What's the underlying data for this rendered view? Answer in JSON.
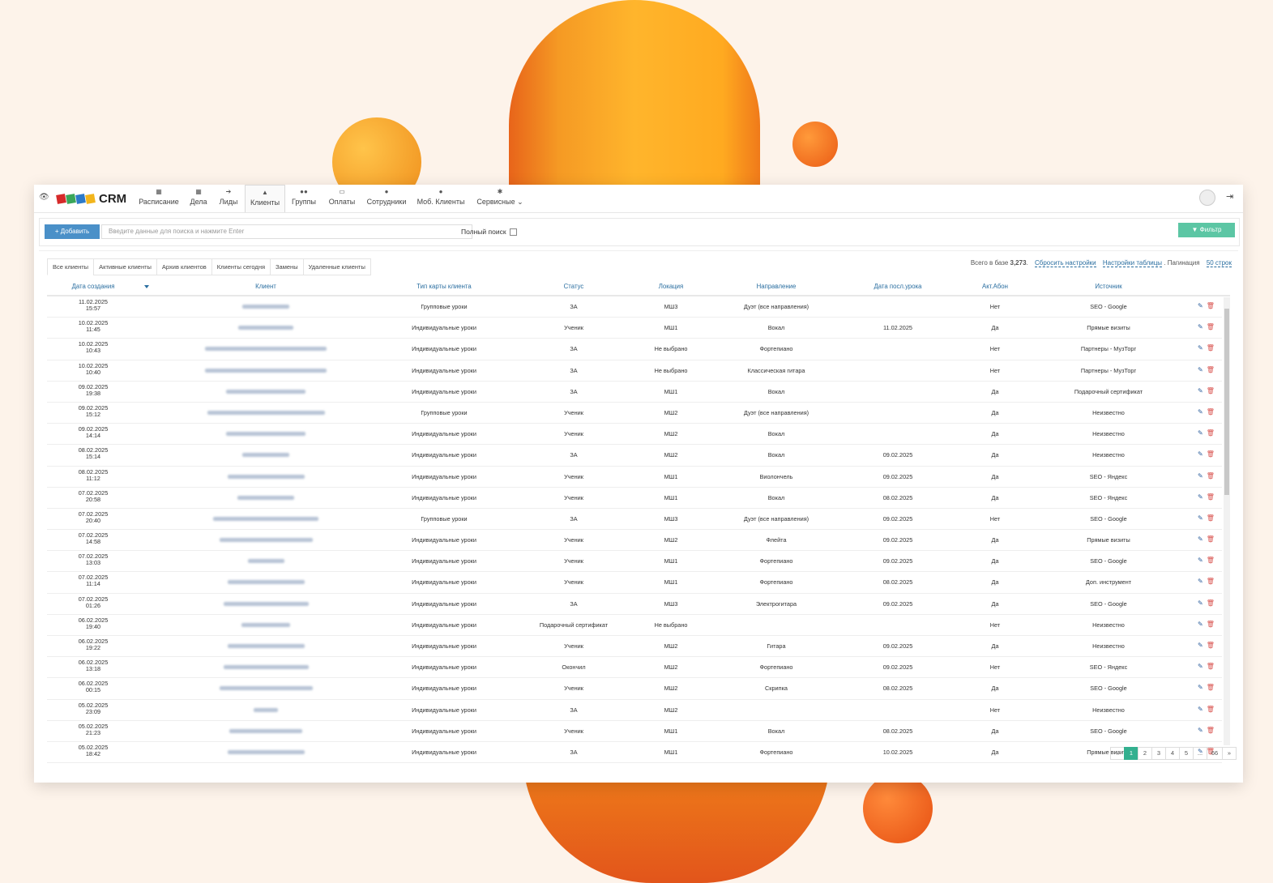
{
  "app": {
    "title": "CRM",
    "logo_colors": [
      "#d62a2a",
      "#3aa65a",
      "#2c7ac9",
      "#f2b51c"
    ]
  },
  "nav": [
    {
      "label": "Расписание",
      "icon": "calendar-icon"
    },
    {
      "label": "Дела",
      "icon": "calendar-check-icon"
    },
    {
      "label": "Лиды",
      "icon": "sign-in-icon"
    },
    {
      "label": "Клиенты",
      "icon": "graduation-cap-icon",
      "active": true
    },
    {
      "label": "Группы",
      "icon": "users-icon"
    },
    {
      "label": "Оплаты",
      "icon": "credit-card-icon"
    },
    {
      "label": "Сотрудники",
      "icon": "user-icon"
    },
    {
      "label": "Моб. Клиенты",
      "icon": "user-icon"
    },
    {
      "label": "Сервисные",
      "icon": "gear-icon"
    }
  ],
  "toolbar": {
    "add_label": "+ Добавить",
    "search_placeholder": "Введите данные для поиска и нажмите Enter",
    "full_search_label": "Полный поиск",
    "filter_label": "▼ Фильтр"
  },
  "tabs": [
    "Все клиенты",
    "Активные клиенты",
    "Архив клиентов",
    "Клиенты сегодня",
    "Замены",
    "Удаленные клиенты"
  ],
  "totals": {
    "prefix": "Всего в базе ",
    "count": "3,273",
    "suffix": ".",
    "reset_label": "Сбросить настройки",
    "table_settings_label": "Настройки таблицы",
    "pagination_prefix": ". Пагинация",
    "pagination_value": "50 строк"
  },
  "columns": [
    "Дата создания",
    "Клиент",
    "Тип карты клиента",
    "Статус",
    "Локация",
    "Направление",
    "Дата посл.урока",
    "Акт.Абон",
    "Источник"
  ],
  "rows": [
    {
      "date": "11.02.2025",
      "time": "15:57",
      "card": "Групповые уроки",
      "status": "ЗА",
      "loc": "МШ3",
      "dir": "Дуэт (все направления)",
      "last": "",
      "abon": "Нет",
      "src": "SEO - Google"
    },
    {
      "date": "10.02.2025",
      "time": "11:45",
      "card": "Индивидуальные уроки",
      "status": "Ученик",
      "loc": "МШ1",
      "dir": "Вокал",
      "last": "11.02.2025",
      "abon": "Да",
      "src": "Прямые визиты"
    },
    {
      "date": "10.02.2025",
      "time": "10:43",
      "card": "Индивидуальные уроки",
      "status": "ЗА",
      "loc": "Не выбрано",
      "dir": "Фортепиано",
      "last": "",
      "abon": "Нет",
      "src": "Партнеры - МузТорг"
    },
    {
      "date": "10.02.2025",
      "time": "10:40",
      "card": "Индивидуальные уроки",
      "status": "ЗА",
      "loc": "Не выбрано",
      "dir": "Классическая гитара",
      "last": "",
      "abon": "Нет",
      "src": "Партнеры - МузТорг"
    },
    {
      "date": "09.02.2025",
      "time": "19:38",
      "card": "Индивидуальные уроки",
      "status": "ЗА",
      "loc": "МШ1",
      "dir": "Вокал",
      "last": "",
      "abon": "Да",
      "src": "Подарочный сертификат"
    },
    {
      "date": "09.02.2025",
      "time": "15:12",
      "card": "Групповые уроки",
      "status": "Ученик",
      "loc": "МШ2",
      "dir": "Дуэт (все направления)",
      "last": "",
      "abon": "Да",
      "src": "Неизвестно"
    },
    {
      "date": "09.02.2025",
      "time": "14:14",
      "card": "Индивидуальные уроки",
      "status": "Ученик",
      "loc": "МШ2",
      "dir": "Вокал",
      "last": "",
      "abon": "Да",
      "src": "Неизвестно"
    },
    {
      "date": "08.02.2025",
      "time": "15:14",
      "card": "Индивидуальные уроки",
      "status": "ЗА",
      "loc": "МШ2",
      "dir": "Вокал",
      "last": "09.02.2025",
      "abon": "Да",
      "src": "Неизвестно"
    },
    {
      "date": "08.02.2025",
      "time": "11:12",
      "card": "Индивидуальные уроки",
      "status": "Ученик",
      "loc": "МШ1",
      "dir": "Виолончель",
      "last": "09.02.2025",
      "abon": "Да",
      "src": "SEO - Яндекс"
    },
    {
      "date": "07.02.2025",
      "time": "20:58",
      "card": "Индивидуальные уроки",
      "status": "Ученик",
      "loc": "МШ1",
      "dir": "Вокал",
      "last": "08.02.2025",
      "abon": "Да",
      "src": "SEO - Яндекс"
    },
    {
      "date": "07.02.2025",
      "time": "20:40",
      "card": "Групповые уроки",
      "status": "ЗА",
      "loc": "МШ3",
      "dir": "Дуэт (все направления)",
      "last": "09.02.2025",
      "abon": "Нет",
      "src": "SEO - Google"
    },
    {
      "date": "07.02.2025",
      "time": "14:58",
      "card": "Индивидуальные уроки",
      "status": "Ученик",
      "loc": "МШ2",
      "dir": "Флейта",
      "last": "09.02.2025",
      "abon": "Да",
      "src": "Прямые визиты"
    },
    {
      "date": "07.02.2025",
      "time": "13:03",
      "card": "Индивидуальные уроки",
      "status": "Ученик",
      "loc": "МШ1",
      "dir": "Фортепиано",
      "last": "09.02.2025",
      "abon": "Да",
      "src": "SEO - Google"
    },
    {
      "date": "07.02.2025",
      "time": "11:14",
      "card": "Индивидуальные уроки",
      "status": "Ученик",
      "loc": "МШ1",
      "dir": "Фортепиано",
      "last": "08.02.2025",
      "abon": "Да",
      "src": "Доп. инструмент"
    },
    {
      "date": "07.02.2025",
      "time": "01:26",
      "card": "Индивидуальные уроки",
      "status": "ЗА",
      "loc": "МШ3",
      "dir": "Электрогитара",
      "last": "09.02.2025",
      "abon": "Да",
      "src": "SEO - Google"
    },
    {
      "date": "06.02.2025",
      "time": "19:40",
      "card": "Индивидуальные уроки",
      "status": "Подарочный сертификат",
      "loc": "Не выбрано",
      "dir": "",
      "last": "",
      "abon": "Нет",
      "src": "Неизвестно"
    },
    {
      "date": "06.02.2025",
      "time": "19:22",
      "card": "Индивидуальные уроки",
      "status": "Ученик",
      "loc": "МШ2",
      "dir": "Гитара",
      "last": "09.02.2025",
      "abon": "Да",
      "src": "Неизвестно"
    },
    {
      "date": "06.02.2025",
      "time": "13:18",
      "card": "Индивидуальные уроки",
      "status": "Окончил",
      "loc": "МШ2",
      "dir": "Фортепиано",
      "last": "09.02.2025",
      "abon": "Нет",
      "src": "SEO - Яндекс"
    },
    {
      "date": "06.02.2025",
      "time": "00:15",
      "card": "Индивидуальные уроки",
      "status": "Ученик",
      "loc": "МШ2",
      "dir": "Скрипка",
      "last": "08.02.2025",
      "abon": "Да",
      "src": "SEO - Google"
    },
    {
      "date": "05.02.2025",
      "time": "23:09",
      "card": "Индивидуальные уроки",
      "status": "ЗА",
      "loc": "МШ2",
      "dir": "",
      "last": "",
      "abon": "Нет",
      "src": "Неизвестно"
    },
    {
      "date": "05.02.2025",
      "time": "21:23",
      "card": "Индивидуальные уроки",
      "status": "Ученик",
      "loc": "МШ1",
      "dir": "Вокал",
      "last": "08.02.2025",
      "abon": "Да",
      "src": "SEO - Google"
    },
    {
      "date": "05.02.2025",
      "time": "18:42",
      "card": "Индивидуальные уроки",
      "status": "ЗА",
      "loc": "МШ1",
      "dir": "Фортепиано",
      "last": "10.02.2025",
      "abon": "Да",
      "src": "Прямые визиты"
    }
  ],
  "pagination": [
    "«",
    "1",
    "2",
    "3",
    "4",
    "5",
    "...",
    "66",
    "»"
  ],
  "pagination_active": "1",
  "colors": {
    "accent": "#2a6ea0",
    "add_button": "#4a90c8",
    "filter_button": "#5cc6a4",
    "page_active": "#33b08f",
    "delete": "#d9534f"
  }
}
